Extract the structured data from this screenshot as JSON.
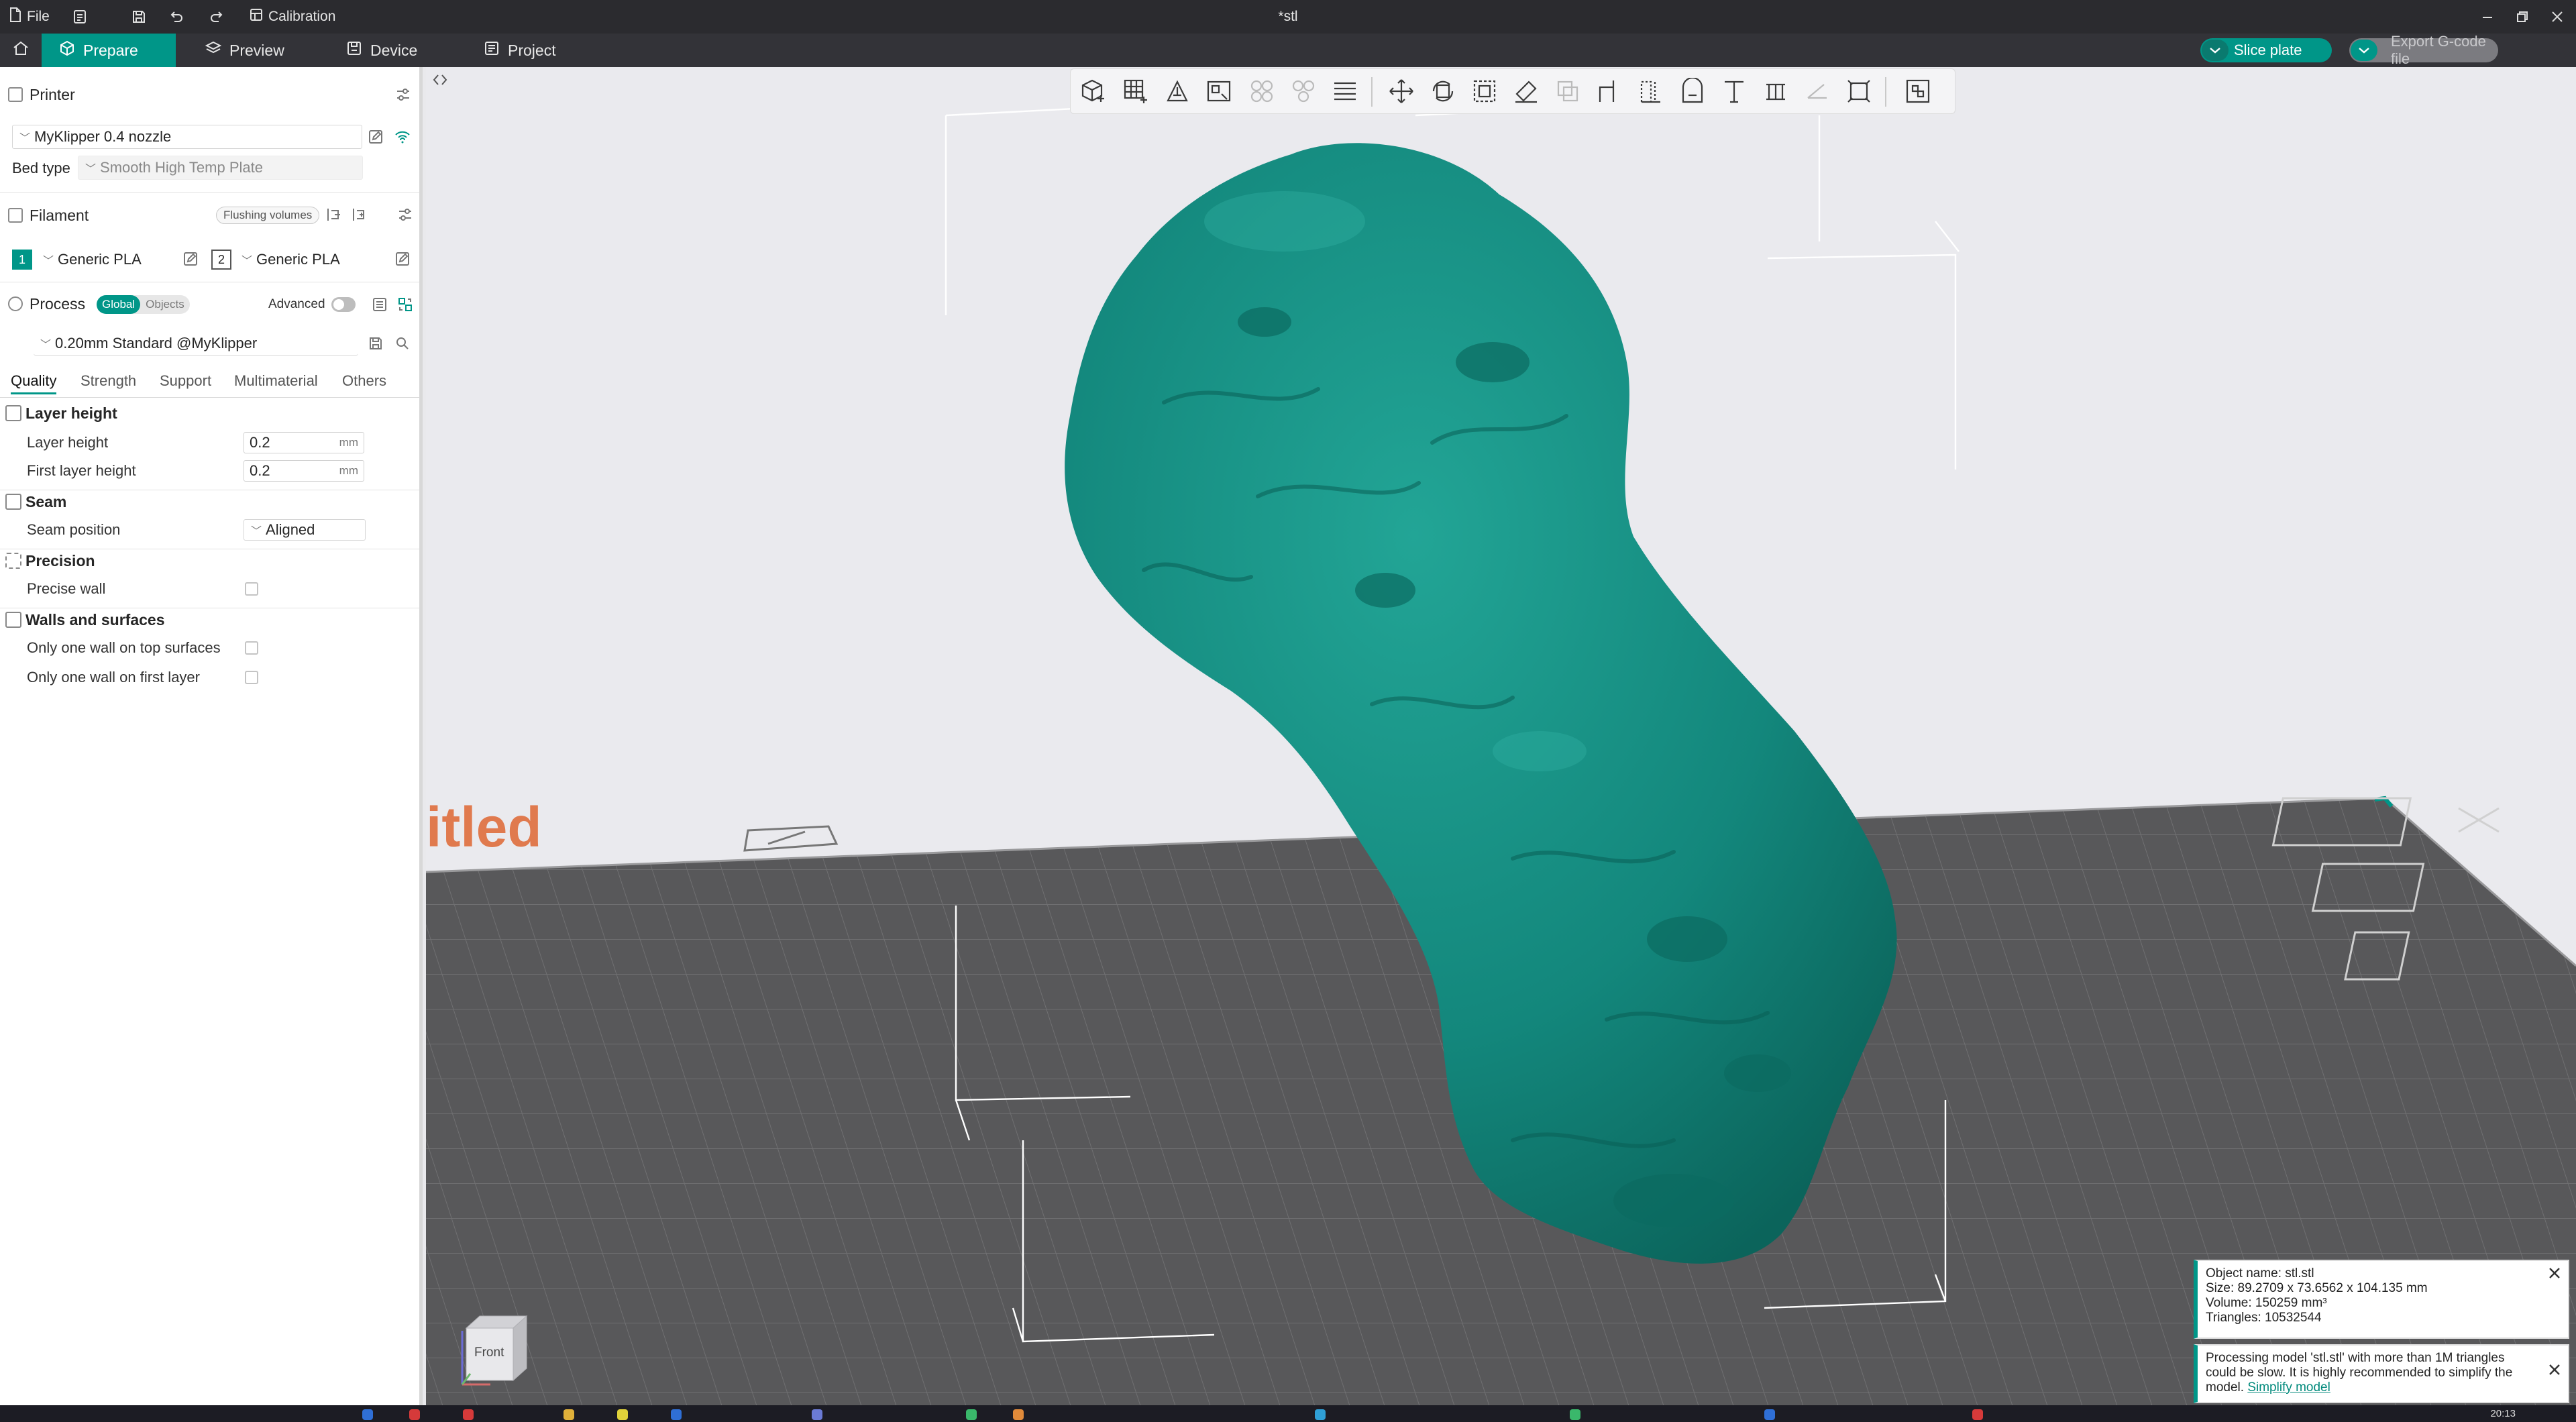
{
  "titlebar": {
    "file_label": "File",
    "calibration_label": "Calibration",
    "doc_title": "*stl"
  },
  "tabs": {
    "prepare": "Prepare",
    "preview": "Preview",
    "device": "Device",
    "project": "Project"
  },
  "actions": {
    "slice": "Slice plate",
    "export": "Export G-code file"
  },
  "printer": {
    "section": "Printer",
    "name": "MyKlipper 0.4 nozzle",
    "bed_type_label": "Bed type",
    "bed_type_value": "Smooth High Temp Plate"
  },
  "filament": {
    "section": "Filament",
    "flushing_label": "Flushing volumes",
    "slots": [
      {
        "number": "1",
        "name": "Generic PLA",
        "color": "#009688"
      },
      {
        "number": "2",
        "name": "Generic PLA",
        "color": "#ffffff"
      }
    ]
  },
  "process": {
    "section": "Process",
    "seg_global": "Global",
    "seg_objects": "Objects",
    "advanced_label": "Advanced",
    "profile": "0.20mm Standard @MyKlipper",
    "subtabs": [
      "Quality",
      "Strength",
      "Support",
      "Multimaterial",
      "Others"
    ],
    "groups": {
      "layer_height": "Layer height",
      "seam": "Seam",
      "precision": "Precision",
      "walls": "Walls and surfaces"
    },
    "options": {
      "layer_height_label": "Layer height",
      "layer_height_value": "0.2",
      "first_layer_height_label": "First layer height",
      "first_layer_height_value": "0.2",
      "unit": "mm",
      "seam_position_label": "Seam position",
      "seam_position_value": "Aligned",
      "precise_wall_label": "Precise wall",
      "one_wall_top_label": "Only one wall on top surfaces",
      "one_wall_first_label": "Only one wall on first layer"
    }
  },
  "viewport": {
    "plate_name": "itled",
    "view_cube_label": "Front"
  },
  "object_info": {
    "name": "Object name: stl.stl",
    "size": "Size: 89.2709 x 73.6562 x 104.135 mm",
    "volume": "Volume: 150259 mm³",
    "triangles": "Triangles: 10532544"
  },
  "notice": {
    "text": "Processing model 'stl.stl' with more than 1M triangles could be slow. It is highly recommended to simplify the model.",
    "link": "Simplify model"
  },
  "taskbar": {
    "time": "20:13"
  },
  "colors": {
    "accent": "#009688",
    "model": "#13877c",
    "plate": "#58585a"
  }
}
